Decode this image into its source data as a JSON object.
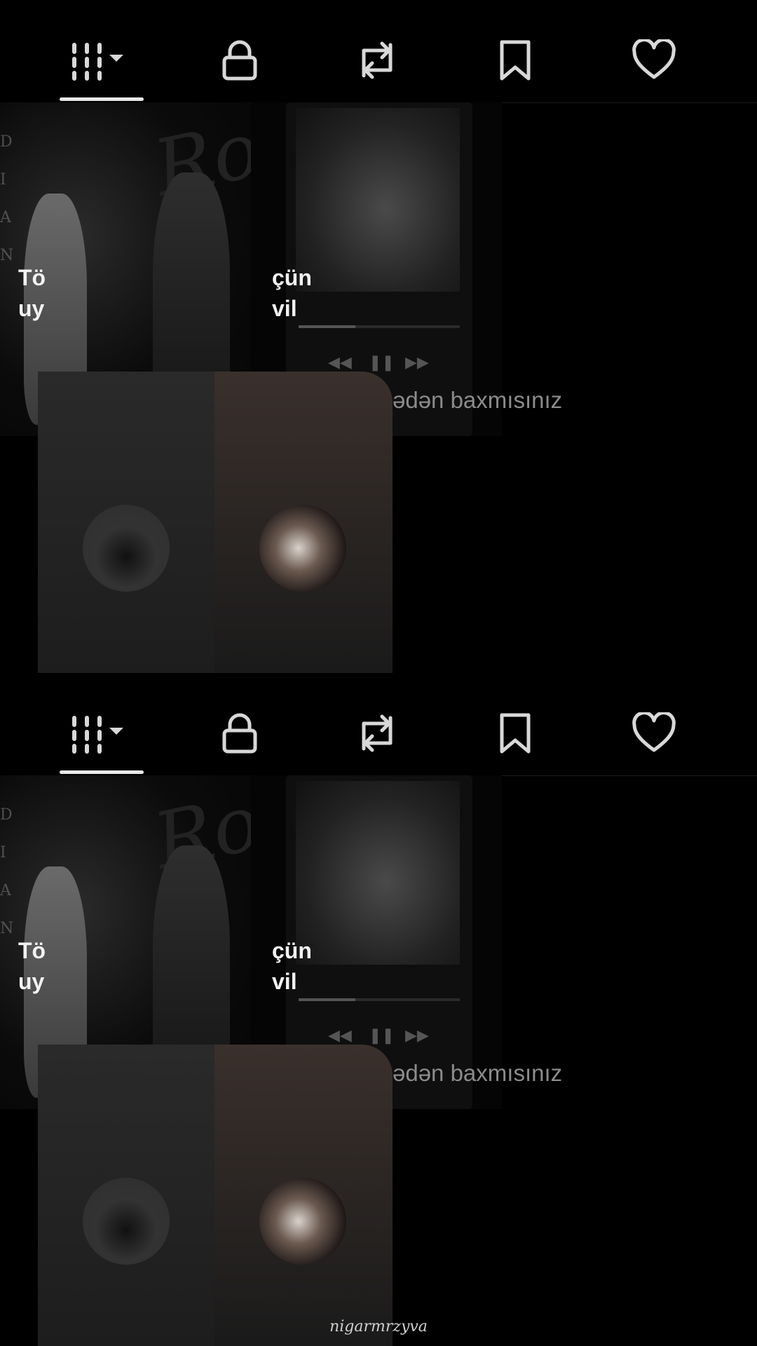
{
  "tabs": [
    {
      "name": "posts",
      "icon": "grid-dropdown-icon",
      "selected": true
    },
    {
      "name": "private",
      "icon": "lock-icon",
      "selected": false
    },
    {
      "name": "reposts",
      "icon": "repost-icon",
      "selected": false
    },
    {
      "name": "favorites",
      "icon": "bookmark-icon",
      "selected": false
    },
    {
      "name": "liked",
      "icon": "heart-icon",
      "selected": false
    }
  ],
  "captions": {
    "left_line1": "Tö",
    "left_line2": "uy",
    "right_line1": "çün",
    "right_line2": "vil"
  },
  "viewed_text": "ədən baxmısınız",
  "watermark": "nigarmrzyva",
  "colors": {
    "background": "#000000",
    "indicator": "#e9e9e9",
    "icon": "#d8d8d8",
    "muted_text": "#8b8b8b"
  }
}
